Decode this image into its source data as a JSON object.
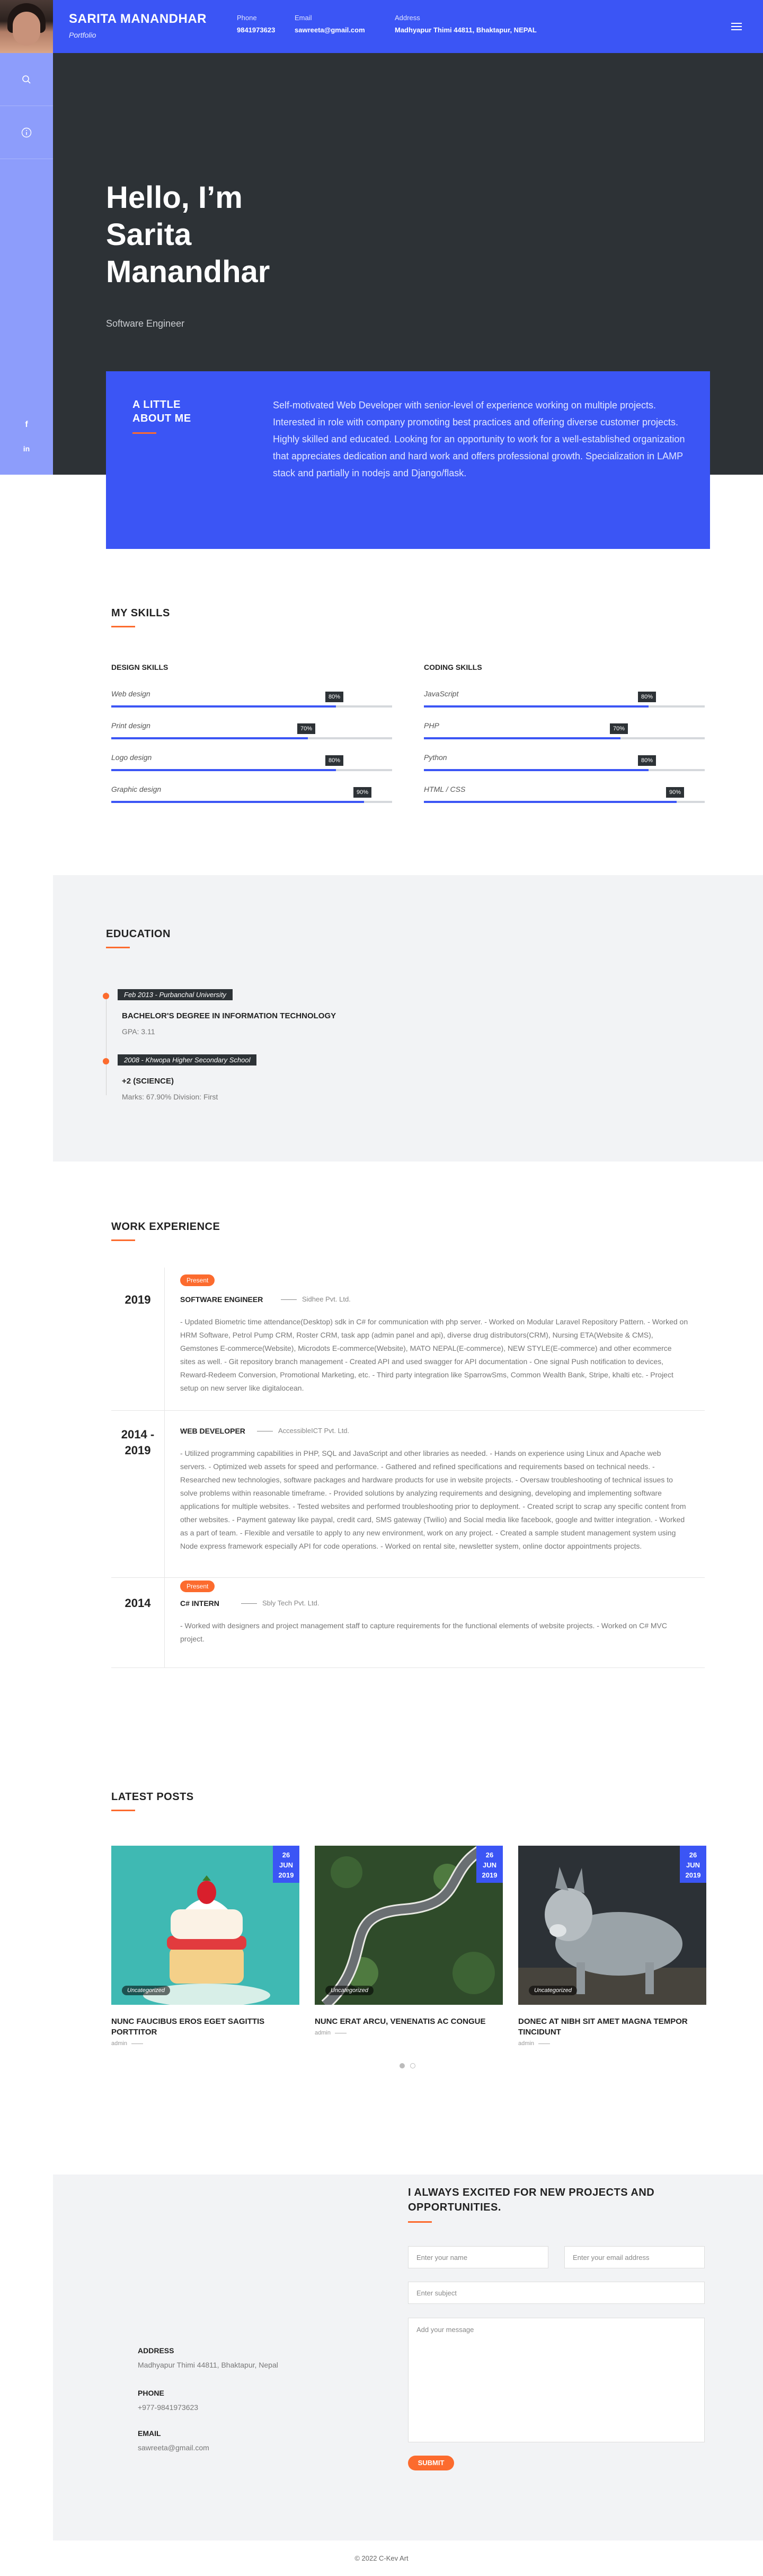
{
  "header": {
    "name": "SARITA MANANDHAR",
    "subtitle": "Portfolio",
    "phone_label": "Phone",
    "phone": "9841973623",
    "email_label": "Email",
    "email": "sawreeta@gmail.com",
    "address_label": "Address",
    "address": "Madhyapur Thimi 44811, Bhaktapur, NEPAL"
  },
  "sidebar": {
    "icons": [
      "search-icon",
      "info-icon"
    ],
    "social": [
      "f",
      "in"
    ]
  },
  "hero": {
    "greeting": "Hello, I’m Sarita Manandhar",
    "role": "Software Engineer"
  },
  "about": {
    "title_line1": "A LITTLE",
    "title_line2": "ABOUT ME",
    "text": "Self-motivated Web Developer with senior-level of experience working on multiple projects. Interested in role with company promoting best practices and offering diverse customer projects. Highly skilled and educated. Looking for an opportunity to work for a well-established organization that appreciates dedication and hard work and offers professional growth. Specialization in LAMP stack and partially in nodejs and Django/flask."
  },
  "skills": {
    "title": "MY SKILLS",
    "design_title": "DESIGN SKILLS",
    "coding_title": "CODING SKILLS",
    "design": [
      {
        "name": "Web design",
        "percent": 80,
        "label": "80%"
      },
      {
        "name": "Print design",
        "percent": 70,
        "label": "70%"
      },
      {
        "name": "Logo design",
        "percent": 80,
        "label": "80%"
      },
      {
        "name": "Graphic design",
        "percent": 90,
        "label": "90%"
      }
    ],
    "coding": [
      {
        "name": "JavaScript",
        "percent": 80,
        "label": "80%"
      },
      {
        "name": "PHP",
        "percent": 70,
        "label": "70%"
      },
      {
        "name": "Python",
        "percent": 80,
        "label": "80%"
      },
      {
        "name": "HTML / CSS",
        "percent": 90,
        "label": "90%"
      }
    ]
  },
  "education": {
    "title": "EDUCATION",
    "items": [
      {
        "tag": "Feb 2013 - Purbanchal University",
        "degree": "BACHELOR'S DEGREE IN INFORMATION TECHNOLOGY",
        "detail": "GPA: 3.11"
      },
      {
        "tag": "2008 - Khwopa Higher Secondary School",
        "degree": "+2 (SCIENCE)",
        "detail": "Marks: 67.90% Division: First"
      }
    ]
  },
  "work": {
    "title": "WORK EXPERIENCE",
    "items": [
      {
        "year": "2019",
        "badge": "Present",
        "role": "SOFTWARE ENGINEER",
        "company": "Sidhee Pvt. Ltd.",
        "desc": "- Updated Biometric time attendance(Desktop) sdk in C# for communication with php server. - Worked on Modular Laravel Repository Pattern. - Worked on HRM Software, Petrol Pump CRM, Roster CRM, task app (admin panel and api), diverse drug distributors(CRM), Nursing ETA(Website & CMS), Gemstones E-commerce(Website), Microdots E-commerce(Website), MATO NEPAL(E-commerce), NEW STYLE(E-commerce) and other ecommerce sites as well. - Git repository branch management - Created API and used swagger for API documentation - One signal Push notification to devices, Reward-Redeem Conversion, Promotional Marketing, etc. - Third party integration like SparrowSms, Common Wealth Bank, Stripe, khalti etc. - Project setup on new server like digitalocean."
      },
      {
        "year": "2014 - 2019",
        "badge": "",
        "role": "WEB DEVELOPER",
        "company": "AccessibleICT Pvt. Ltd.",
        "desc": "- Utilized programming capabilities in PHP, SQL and JavaScript and other libraries as needed. - Hands on experience using Linux and Apache web servers. - Optimized web assets for speed and performance. - Gathered and refined specifications and requirements based on technical needs. - Researched new technologies, software packages and hardware products for use in website projects. - Oversaw troubleshooting of technical issues to solve problems within reasonable timeframe. - Provided solutions by analyzing requirements and designing, developing and implementing software applications for multiple websites. - Tested websites and performed troubleshooting prior to deployment. - Created script to scrap any specific content from other websites. - Payment gateway like paypal, credit card, SMS gateway (Twilio) and Social media like facebook, google and twitter integration. - Worked as a part of team. - Flexible and versatile to apply to any new environment, work on any project. - Created a sample student management system using Node express framework especially API for code operations. - Worked on rental site, newsletter system, online doctor appointments projects."
      },
      {
        "year": "2014",
        "badge": "Present",
        "role": "C# INTERN",
        "company": "Sbly Tech Pvt. Ltd.",
        "desc": "- Worked with designers and project management staff to capture requirements for the functional elements of website projects. - Worked on C# MVC project."
      }
    ]
  },
  "posts": {
    "title": "LATEST POSTS",
    "items": [
      {
        "day": "26",
        "month": "JUN",
        "year": "2019",
        "category": "Uncategorized",
        "title": "NUNC FAUCIBUS EROS EGET SAGITTIS PORTTITOR",
        "meta": "admin"
      },
      {
        "day": "26",
        "month": "JUN",
        "year": "2019",
        "category": "Uncategorized",
        "title": "NUNC ERAT ARCU, VENENATIS AC CONGUE",
        "meta": "admin"
      },
      {
        "day": "26",
        "month": "JUN",
        "year": "2019",
        "category": "Uncategorized",
        "title": "DONEC AT NIBH SIT AMET MAGNA TEMPOR TINCIDUNT",
        "meta": "admin"
      }
    ]
  },
  "contact": {
    "heading": "I ALWAYS EXCITED FOR NEW PROJECTS AND OPPORTUNITIES.",
    "name_placeholder": "Enter your name",
    "email_placeholder": "Enter your email address",
    "subject_placeholder": "Enter subject",
    "message_placeholder": "Add your message",
    "submit": "SUBMIT",
    "address_label": "ADDRESS",
    "address": "Madhyapur Thimi 44811, Bhaktapur, Nepal",
    "phone_label": "PHONE",
    "phone": "+977-9841973623",
    "email_label": "EMAIL",
    "email": "sawreeta@gmail.com"
  },
  "footer": {
    "text": "© 2022 C-Kev Art"
  },
  "colors": {
    "accent": "#3b55f5",
    "orange": "#fc6b2e",
    "dark": "#2d3236"
  }
}
